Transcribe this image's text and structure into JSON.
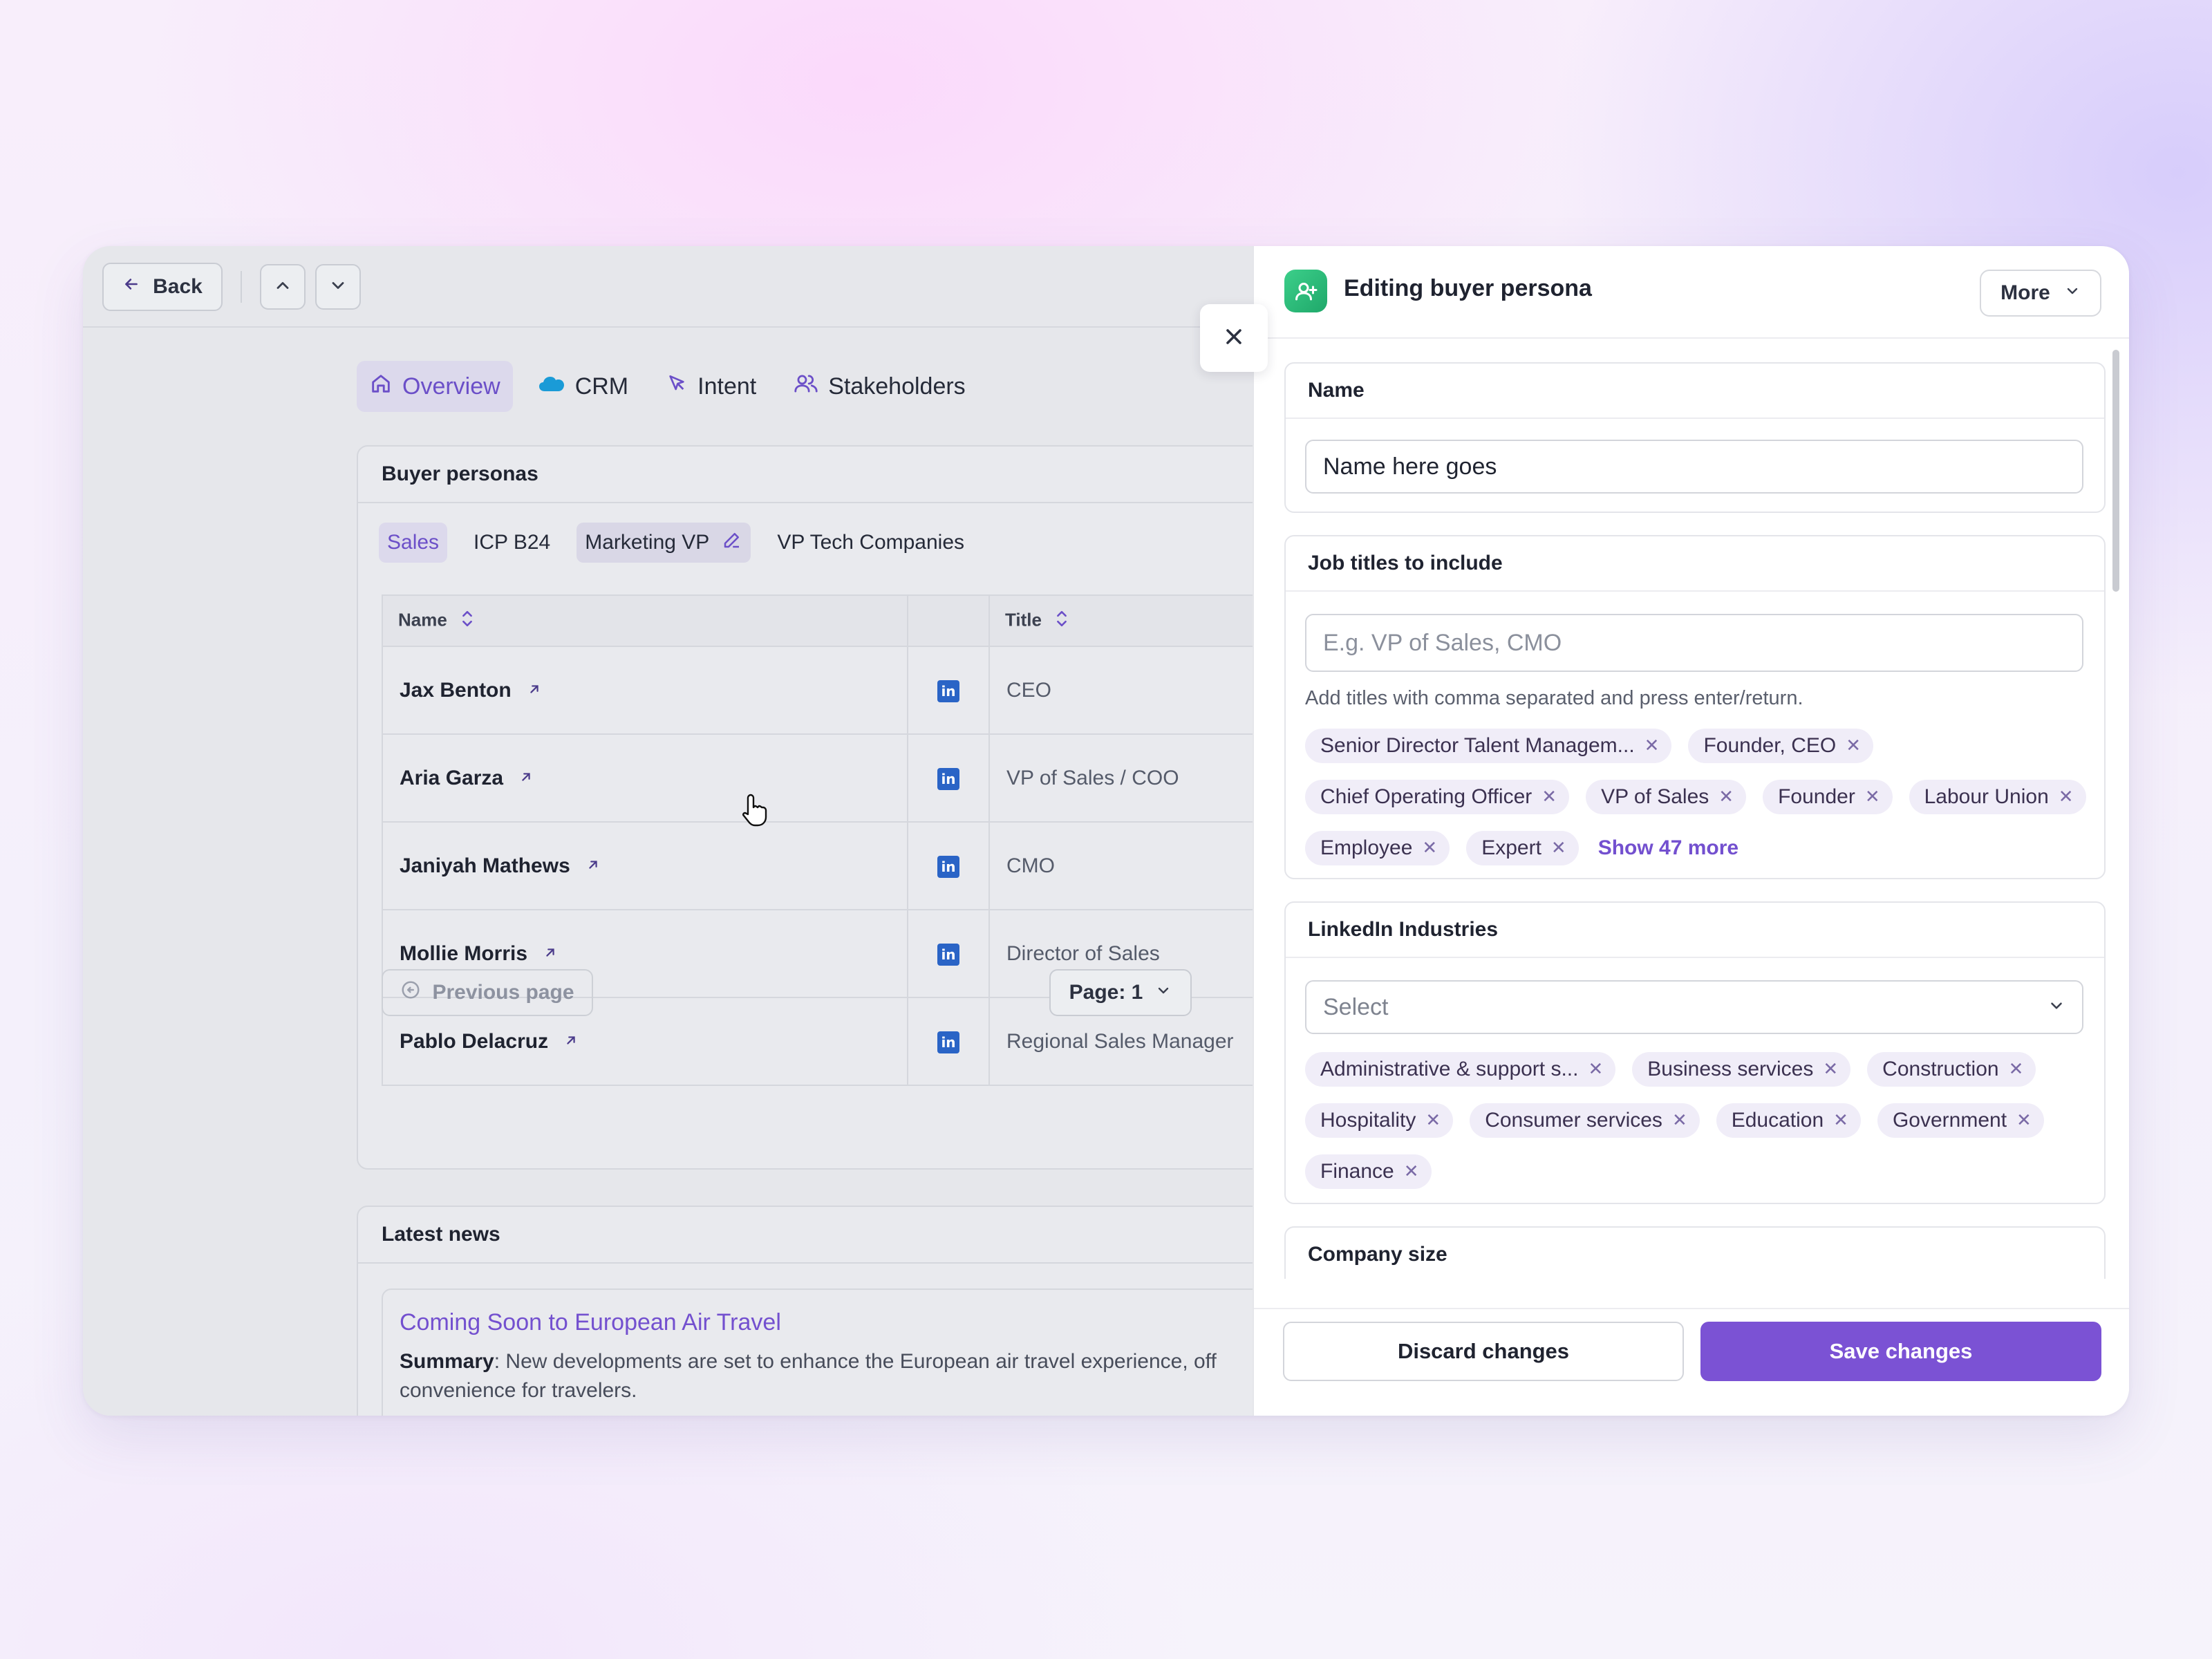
{
  "topbar": {
    "back_label": "Back"
  },
  "nav": {
    "tabs": [
      {
        "label": "Overview",
        "icon": "home-icon",
        "active": true
      },
      {
        "label": "CRM",
        "icon": "salesforce-cloud-icon"
      },
      {
        "label": "Intent",
        "icon": "cursor-arrow-icon"
      },
      {
        "label": "Stakeholders",
        "icon": "users-icon"
      }
    ]
  },
  "personas": {
    "title": "Buyer personas",
    "tabs": [
      "Sales",
      "ICP B24",
      "Marketing VP",
      "VP Tech Companies"
    ],
    "columns": {
      "name": "Name",
      "title": "Title"
    },
    "rows": [
      {
        "name": "Jax Benton",
        "title": "CEO"
      },
      {
        "name": "Aria Garza",
        "title": "VP of Sales / COO"
      },
      {
        "name": "Janiyah Mathews",
        "title": "CMO"
      },
      {
        "name": "Mollie Morris",
        "title": "Director of Sales"
      },
      {
        "name": "Pablo Delacruz",
        "title": "Regional Sales Manager"
      }
    ],
    "prev_label": "Previous page",
    "page_label": "Page: 1"
  },
  "news": {
    "title": "Latest news",
    "item_title": "Coming Soon to European Air Travel",
    "summary_label": "Summary",
    "summary_text": ": New developments are set to enhance the European air travel experience, off",
    "summary_text_2": "convenience for travelers."
  },
  "drawer": {
    "title": "Editing buyer persona",
    "more_label": "More",
    "name_section": {
      "label": "Name",
      "value": "Name here goes"
    },
    "job_section": {
      "label": "Job titles to include",
      "placeholder": "E.g. VP of Sales, CMO",
      "hint": "Add titles with comma separated and press enter/return.",
      "chips": [
        "Senior Director Talent Managem...",
        "Founder, CEO",
        "Chief Operating Officer",
        "VP of Sales",
        "Founder",
        "Labour Union",
        "Employee",
        "Expert"
      ],
      "show_more": "Show 47 more"
    },
    "industries_section": {
      "label": "LinkedIn Industries",
      "select_placeholder": "Select",
      "chips": [
        "Administrative & support s...",
        "Business services",
        "Construction",
        "Hospitality",
        "Consumer services",
        "Education",
        "Government",
        "Finance"
      ]
    },
    "company_size_section": {
      "label": "Company size"
    },
    "discard_label": "Discard changes",
    "save_label": "Save changes"
  },
  "colors": {
    "accent": "#7b52d4",
    "chip_bg": "#f0edf8",
    "linkedin": "#2a64c6"
  }
}
